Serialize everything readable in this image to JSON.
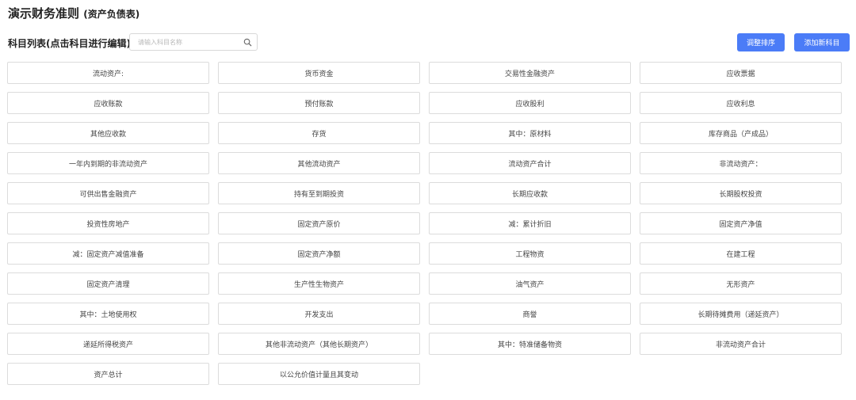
{
  "header": {
    "title": "演示财务准则",
    "subtitle": "(资产负债表)"
  },
  "list": {
    "title": "科目列表(点击科目进行编辑)"
  },
  "search": {
    "placeholder": "请输入科目名称",
    "value": "",
    "icon": "search-icon"
  },
  "toolbar": {
    "sort_label": "调整排序",
    "add_label": "添加新科目",
    "accent_color": "#4b7cf7"
  },
  "subjects": [
    "流动资产:",
    "货币资金",
    "交易性金融资产",
    "应收票据",
    "应收账款",
    "预付账款",
    "应收股利",
    "应收利息",
    "其他应收款",
    "存货",
    "其中：原材料",
    "库存商品（产成品）",
    "一年内到期的非流动资产",
    "其他流动资产",
    "流动资产合计",
    "非流动资产：",
    "可供出售金融资产",
    "持有至到期投资",
    "长期应收款",
    "长期股权投资",
    "投资性房地产",
    "固定资产原价",
    "减：累计折旧",
    "固定资产净值",
    "减：固定资产减值准备",
    "固定资产净额",
    "工程物资",
    "在建工程",
    "固定资产清理",
    "生产性生物资产",
    "油气资产",
    "无形资产",
    "其中：土地使用权",
    "开发支出",
    "商誉",
    "长期待摊费用（递延资产）",
    "递延所得税资产",
    "其他非流动资产（其他长期资产）",
    "其中：特准储备物资",
    "非流动资产合计",
    "资产总计",
    "以公允价值计量且其变动"
  ]
}
